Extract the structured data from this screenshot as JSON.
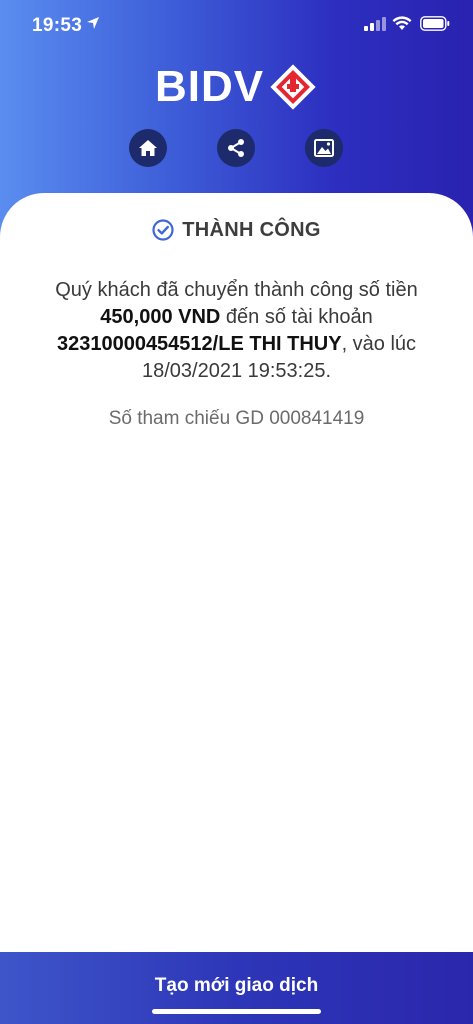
{
  "status_bar": {
    "time": "19:53"
  },
  "brand": {
    "name": "BIDV",
    "color_primary": "#2d2fc0",
    "color_red": "#e3262f"
  },
  "toolbar": {
    "icons": [
      "home-icon",
      "share-icon",
      "image-icon"
    ]
  },
  "result": {
    "status_label": "THÀNH CÔNG",
    "message_prefix": "Quý khách đã chuyển thành công số tiền",
    "amount": "450,000 VND",
    "message_mid": "đến số tài khoản",
    "account": "32310000454512/LE THI THUY",
    "message_suffix": ", vào lúc",
    "datetime": "18/03/2021 19:53:25.",
    "reference": "Số tham chiếu GD 000841419"
  },
  "footer": {
    "new_transaction_label": "Tạo mới giao dịch"
  }
}
